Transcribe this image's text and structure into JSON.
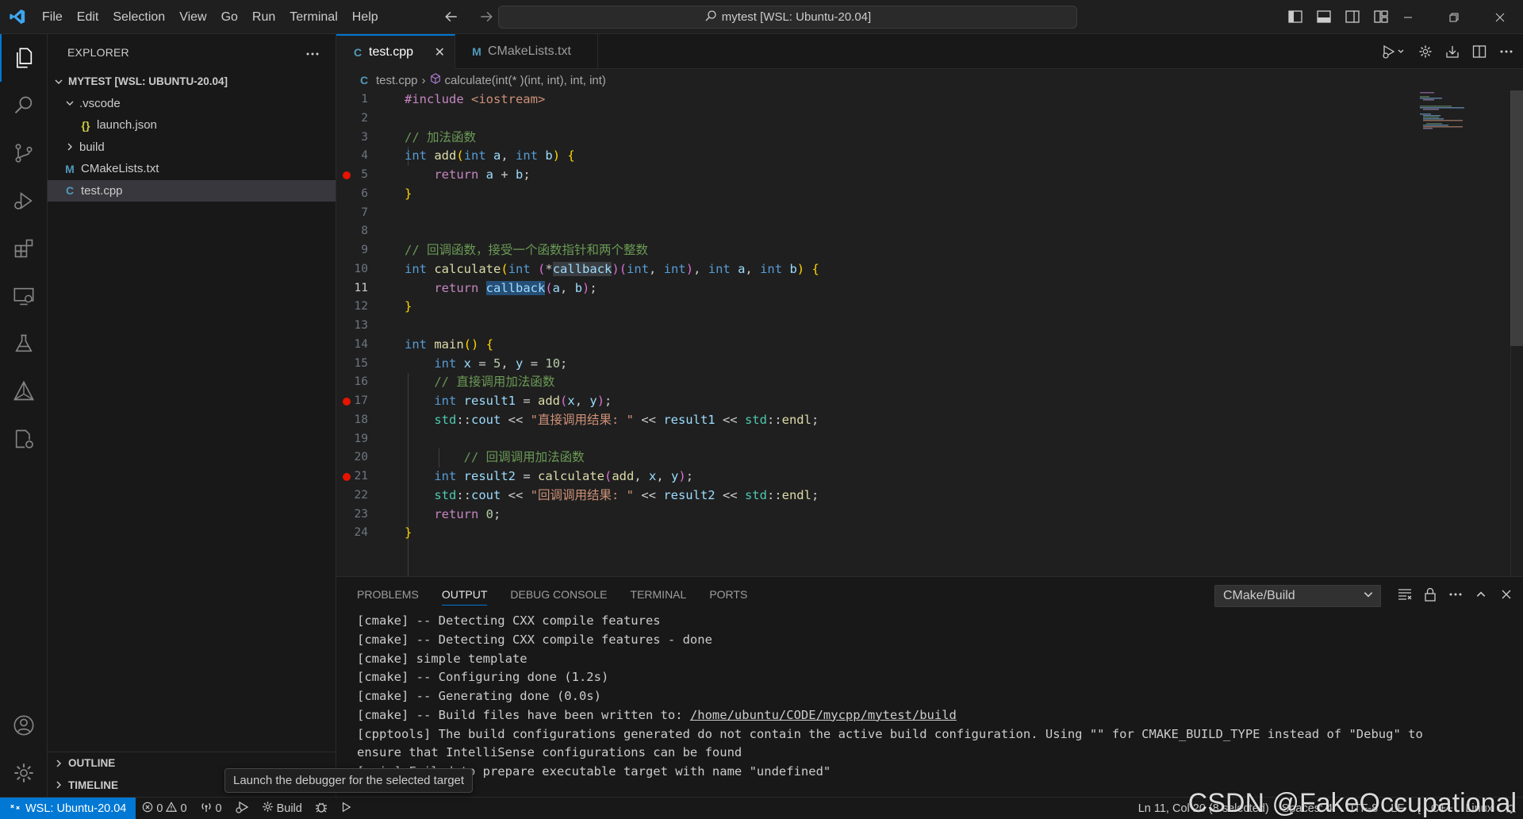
{
  "menus": [
    "File",
    "Edit",
    "Selection",
    "View",
    "Go",
    "Run",
    "Terminal",
    "Help"
  ],
  "command_center": "mytest [WSL: Ubuntu-20.04]",
  "sidebar": {
    "title": "EXPLORER",
    "root": "MYTEST [WSL: UBUNTU-20.04]",
    "items": [
      {
        "label": ".vscode",
        "kind": "folder-open"
      },
      {
        "label": "launch.json",
        "kind": "json"
      },
      {
        "label": "build",
        "kind": "folder-closed"
      },
      {
        "label": "CMakeLists.txt",
        "kind": "cmake"
      },
      {
        "label": "test.cpp",
        "kind": "cpp"
      }
    ],
    "outline": "OUTLINE",
    "timeline": "TIMELINE"
  },
  "tabs": [
    {
      "label": "test.cpp",
      "active": true
    },
    {
      "label": "CMakeLists.txt",
      "active": false
    }
  ],
  "breadcrumb": {
    "file": "test.cpp",
    "symbol": "calculate(int(* )(int, int), int, int)"
  },
  "editor": {
    "line_numbers": [
      "1",
      "2",
      "3",
      "4",
      "5",
      "6",
      "7",
      "8",
      "9",
      "10",
      "11",
      "12",
      "13",
      "14",
      "15",
      "16",
      "17",
      "18",
      "19",
      "20",
      "21",
      "22",
      "23",
      "24"
    ],
    "current_line": "11",
    "breakpoint_lines": [
      "5",
      "17",
      "21"
    ],
    "code": {
      "l1_pp": "#include",
      "l1_hdr": " <iostream>",
      "l3": "// 加法函数",
      "l4_int": "int",
      "l4_fn": "add",
      "l4_int2": "int",
      "l4_a": "a",
      "l4_int3": "int",
      "l4_b": "b",
      "l5_ret": "return",
      "l5_a": "a",
      "l5_b": "b",
      "l9": "// 回调函数，接受一个函数指针和两个整数",
      "l10_int": "int",
      "l10_fn": "calculate",
      "l10_int2": "int",
      "l10_cb": "callback",
      "l10_int3": "int",
      "l10_int4": "int",
      "l10_int5": "int",
      "l10_a": "a",
      "l10_int6": "int",
      "l10_b": "b",
      "l11_ret": "return",
      "l11_cb": "callback",
      "l11_a": "a",
      "l11_b": "b",
      "l14_int": "int",
      "l14_fn": "main",
      "l15_int": "int",
      "l15_x": "x",
      "l15_5": "5",
      "l15_y": "y",
      "l15_10": "10",
      "l16": "// 直接调用加法函数",
      "l17_int": "int",
      "l17_r": "result1",
      "l17_fn": "add",
      "l17_x": "x",
      "l17_y": "y",
      "l18_std": "std",
      "l18_cout": "cout",
      "l18_str": "\"直接调用结果: \"",
      "l18_r": "result1",
      "l18_std2": "std",
      "l18_endl": "endl",
      "l20": "// 回调调用加法函数",
      "l21_int": "int",
      "l21_r": "result2",
      "l21_fn": "calculate",
      "l21_add": "add",
      "l21_x": "x",
      "l21_y": "y",
      "l22_std": "std",
      "l22_cout": "cout",
      "l22_str": "\"回调调用结果: \"",
      "l22_r": "result2",
      "l22_std2": "std",
      "l22_endl": "endl",
      "l23_ret": "return",
      "l23_0": "0"
    }
  },
  "panel": {
    "tabs": [
      "PROBLEMS",
      "OUTPUT",
      "DEBUG CONSOLE",
      "TERMINAL",
      "PORTS"
    ],
    "active_tab": "OUTPUT",
    "output_channel": "CMake/Build",
    "output": [
      "[cmake] -- Detecting CXX compile features",
      "[cmake] -- Detecting CXX compile features - done",
      "[cmake] simple template",
      "[cmake] -- Configuring done (1.2s)",
      "[cmake] -- Generating done (0.0s)",
      "[cmake] -- Build files have been written to: ",
      "[cpptools] The build configurations generated do not contain the active build configuration. Using \"\" for CMAKE_BUILD_TYPE instead of \"Debug\" to",
      "ensure that IntelliSense configurations can be found",
      "[main] Failed to prepare executable target with name \"undefined\""
    ],
    "output_link": "/home/ubuntu/CODE/mycpp/mytest/build"
  },
  "tooltip": "Launch the debugger for the selected target",
  "statusbar": {
    "remote": "WSL: Ubuntu-20.04",
    "errors": "0",
    "warnings": "0",
    "ports": "0",
    "build": "Build",
    "position": "Ln 11, Col 20 (8 selected)",
    "spaces": "Spaces: 4",
    "encoding": "UTF-8",
    "eol": "LF",
    "language": "C++",
    "platform": "Linux"
  },
  "watermark": "CSDN @FakeOccupational",
  "colors": {
    "accent": "#0078d4",
    "breakpoint": "#e51400",
    "keyword": "#569cd6",
    "function": "#dcdcaa",
    "comment": "#6a9955",
    "string": "#ce9178"
  }
}
